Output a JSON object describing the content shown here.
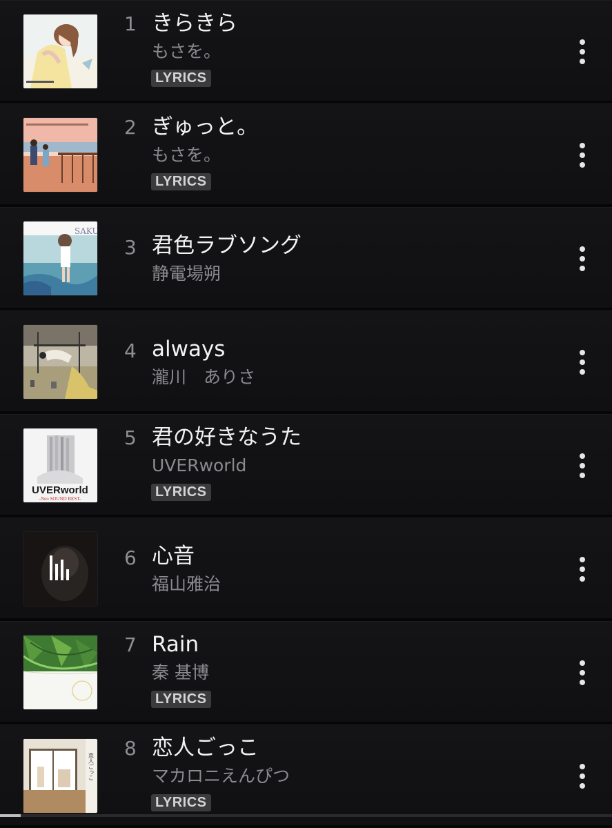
{
  "tracks": [
    {
      "number": "1",
      "title": "きらきら",
      "artist": "もさを。",
      "badge": "LYRICS",
      "art_icon": "album-art-illustrated-girl"
    },
    {
      "number": "2",
      "title": "ぎゅっと。",
      "artist": "もさを。",
      "badge": "LYRICS",
      "art_icon": "album-art-couple-waterfront"
    },
    {
      "number": "3",
      "title": "君色ラブソング",
      "artist": "静電場朔",
      "badge": "",
      "art_icon": "album-art-seaside-photo"
    },
    {
      "number": "4",
      "title": "always",
      "artist": "瀧川　ありさ",
      "badge": "",
      "art_icon": "album-art-room-interior"
    },
    {
      "number": "5",
      "title": "君の好きなうた",
      "artist": "UVERworld",
      "badge": "LYRICS",
      "art_icon": "album-art-uverworld"
    },
    {
      "number": "6",
      "title": "心音",
      "artist": "福山雅治",
      "badge": "",
      "art_icon": "album-art-now-playing"
    },
    {
      "number": "7",
      "title": "Rain",
      "artist": "秦 基博",
      "badge": "LYRICS",
      "art_icon": "album-art-green-leaves"
    },
    {
      "number": "8",
      "title": "恋人ごっこ",
      "artist": "マカロニえんぴつ",
      "badge": "LYRICS",
      "art_icon": "album-art-room-curtains"
    }
  ],
  "more_icon": "more-vertical-icon",
  "equalizer_icon": "now-playing-equalizer-icon",
  "art5_text": {
    "line1": "UVERworld",
    "line2": "-Neo SOUND BEST-"
  },
  "art3_text": "SAKU",
  "colors": {
    "background": "#101011",
    "title": "#f2f2f2",
    "artist": "#8a8a8f",
    "badge_bg": "#3b3b3e",
    "badge_text": "#d4d4d6"
  }
}
